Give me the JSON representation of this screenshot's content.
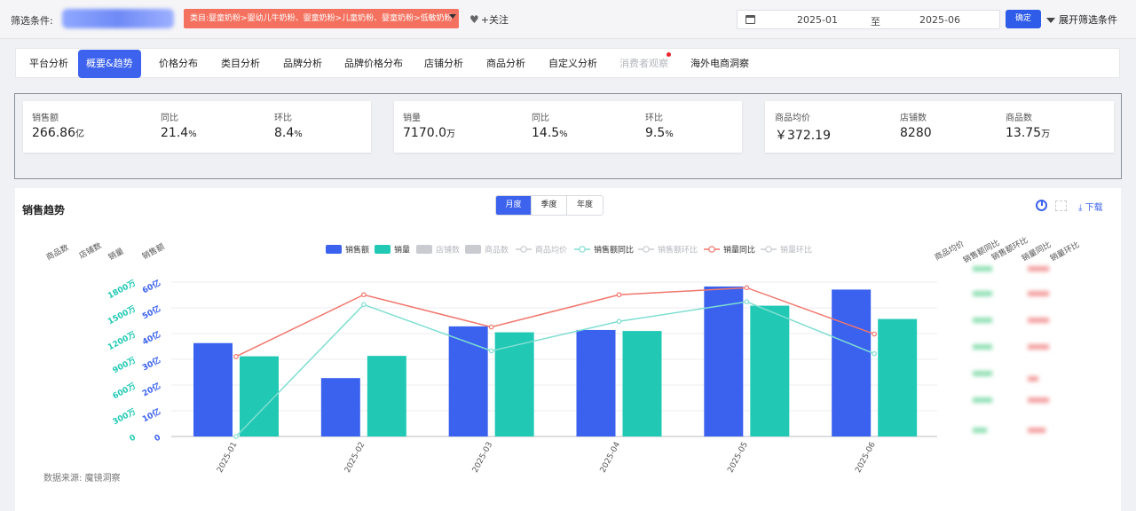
{
  "filter": {
    "label": "筛选条件:",
    "category_tag": "类目:婴童奶粉>婴幼儿牛奶粉、婴童奶粉>儿童奶粉、婴童奶粉>低敏奶粉",
    "follow": "+关注",
    "date_start": "2025-01",
    "date_to": "至",
    "date_end": "2025-06",
    "confirm": "确定",
    "expand": "展开筛选条件"
  },
  "tabs": [
    {
      "label": "平台分析"
    },
    {
      "label": "概要&趋势",
      "active": true
    },
    {
      "label": "价格分布"
    },
    {
      "label": "类目分析"
    },
    {
      "label": "品牌分析"
    },
    {
      "label": "品牌价格分布"
    },
    {
      "label": "店铺分析"
    },
    {
      "label": "商品分析"
    },
    {
      "label": "自定义分析"
    },
    {
      "label": "消费者观察",
      "disabled": true
    },
    {
      "label": "海外电商洞察"
    }
  ],
  "kpi": [
    [
      {
        "name": "销售额",
        "value": "266.86",
        "unit": "亿"
      },
      {
        "name": "同比",
        "value": "21.4",
        "unit": "%"
      },
      {
        "name": "环比",
        "value": "8.4",
        "unit": "%"
      }
    ],
    [
      {
        "name": "销量",
        "value": "7170.0",
        "unit": "万"
      },
      {
        "name": "同比",
        "value": "14.5",
        "unit": "%"
      },
      {
        "name": "环比",
        "value": "9.5",
        "unit": "%"
      }
    ],
    [
      {
        "name": "商品均价",
        "value": "￥372.19",
        "unit": ""
      },
      {
        "name": "店铺数",
        "value": "8280",
        "unit": ""
      },
      {
        "name": "商品数",
        "value": "13.75",
        "unit": "万"
      }
    ]
  ],
  "trend": {
    "title": "销售趋势",
    "periods": [
      "月度",
      "季度",
      "年度"
    ],
    "active_period": "月度",
    "download": "下载",
    "source": "数据来源: 魔镜洞察"
  },
  "chart_data": {
    "type": "bar",
    "categories": [
      "2025-01",
      "2025-02",
      "2025-03",
      "2025-04",
      "2025-05",
      "2025-06"
    ],
    "series": [
      {
        "name": "销售额",
        "kind": "bar",
        "axis": "left-sales",
        "values": [
          36.3,
          22.7,
          42.8,
          41.4,
          58.3,
          57.1
        ],
        "color": "#3b62ef",
        "visible": true
      },
      {
        "name": "销量",
        "kind": "bar",
        "axis": "left-volume",
        "values": [
          935,
          940,
          1215,
          1230,
          1525,
          1370
        ],
        "color": "#21c9b5",
        "visible": true
      },
      {
        "name": "店铺数",
        "kind": "bar",
        "visible": false
      },
      {
        "name": "商品数",
        "kind": "bar",
        "visible": false
      },
      {
        "name": "商品均价",
        "kind": "line",
        "visible": false
      },
      {
        "name": "销售额同比",
        "kind": "line",
        "axis": "right",
        "values": [
          -0.5,
          0.44,
          0.11,
          0.32,
          0.46,
          0.09
        ],
        "color": "#7fded2",
        "visible": true
      },
      {
        "name": "销售额环比",
        "kind": "line",
        "visible": false
      },
      {
        "name": "销量同比",
        "kind": "line",
        "axis": "right",
        "values": [
          0.07,
          0.51,
          0.28,
          0.51,
          0.56,
          0.23
        ],
        "color": "#f1766c",
        "visible": true
      },
      {
        "name": "销量环比",
        "kind": "line",
        "visible": false
      }
    ],
    "left_axes": [
      {
        "title": "销售额",
        "ticks": [
          "0",
          "10亿",
          "20亿",
          "30亿",
          "40亿",
          "50亿",
          "60亿"
        ],
        "color": "#3b62ef"
      },
      {
        "title": "销量",
        "ticks": [
          "0",
          "300万",
          "600万",
          "900万",
          "1200万",
          "1500万",
          "1800万"
        ],
        "color": "#21c9b5"
      },
      {
        "title": "店铺数",
        "ticks": []
      },
      {
        "title": "商品数",
        "ticks": []
      }
    ],
    "right_axes": [
      "商品均价",
      "销售额同比",
      "销售额环比",
      "销量同比",
      "销量环比"
    ],
    "ylim_sales": [
      0,
      60
    ],
    "ylim_volume": [
      0,
      1800
    ],
    "legend_position": "top-center",
    "grid": true
  },
  "colors": {
    "accent": "#3d63ee",
    "tag": "#f4715f",
    "sales_bar": "#3b62ef",
    "volume_bar": "#21c9b5",
    "yoy_sales_line": "#7fded2",
    "yoy_volume_line": "#f1766c"
  }
}
